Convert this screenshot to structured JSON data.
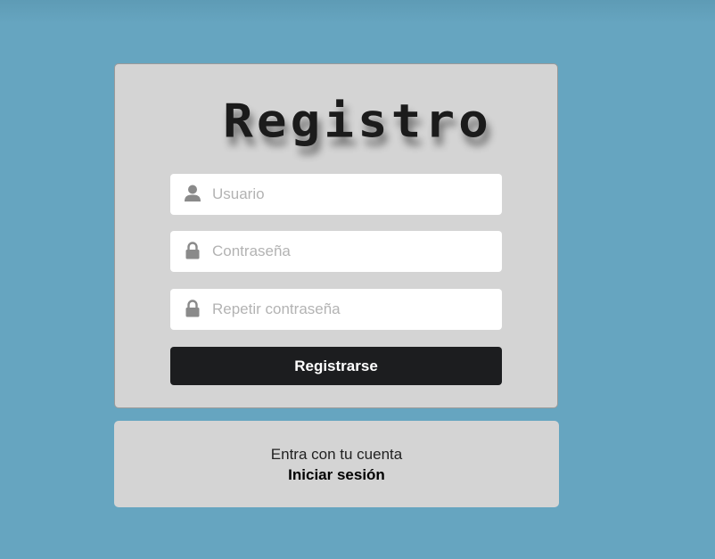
{
  "register": {
    "title": "Registro",
    "fields": [
      {
        "placeholder": "Usuario",
        "icon": "user-icon"
      },
      {
        "placeholder": "Contraseña",
        "icon": "lock-icon"
      },
      {
        "placeholder": "Repetir contraseña",
        "icon": "lock-icon"
      }
    ],
    "submit_label": "Registrarse"
  },
  "login": {
    "prompt": "Entra con tu cuenta",
    "link_label": "Iniciar sesión"
  },
  "colors": {
    "background": "#66a5c0",
    "card": "#d4d4d4",
    "button": "#1c1d1f",
    "icon": "#8a8a8a"
  }
}
